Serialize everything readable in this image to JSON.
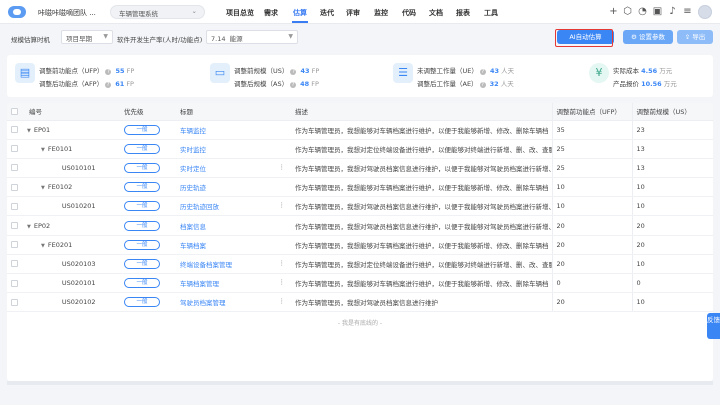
{
  "header": {
    "team_name": "咔嗞咔嗞嘀团队 ...",
    "project_select": "车辆管理系统",
    "nav": [
      {
        "label": "项目总览",
        "active": false
      },
      {
        "label": "需求",
        "active": false
      },
      {
        "label": "估算",
        "active": true
      },
      {
        "label": "迭代",
        "active": false
      },
      {
        "label": "评审",
        "active": false
      },
      {
        "label": "监控",
        "active": false
      },
      {
        "label": "代码",
        "active": false
      },
      {
        "label": "文档",
        "active": false
      },
      {
        "label": "报表",
        "active": false
      },
      {
        "label": "工具",
        "active": false
      }
    ],
    "icons": [
      "plus-icon",
      "cube-icon",
      "pie-chart-icon",
      "calendar-icon",
      "bell-icon",
      "settings-sliders-icon",
      "avatar"
    ]
  },
  "filters": {
    "timing_label": "规模估算时机",
    "timing_value": "项目早期",
    "productivity_label": "软件开发生产率(人时/功能点)",
    "productivity_value": "7.14",
    "productivity_level": "能源"
  },
  "actions": {
    "ai_estimate": "AI自动估算",
    "set_params": "设置参数",
    "export": "导出"
  },
  "summary": {
    "ufp_label": "调整前功能点（UFP）",
    "ufp_value": "55",
    "ufp_unit": "FP",
    "afp_label": "调整后功能点（AFP）",
    "afp_value": "61",
    "afp_unit": "FP",
    "us_label": "调整前规模（US）",
    "us_value": "43",
    "us_unit": "FP",
    "as_label": "调整后规模（AS）",
    "as_value": "48",
    "as_unit": "FP",
    "ue_label": "未调整工作量（UE）",
    "ue_value": "43",
    "ue_unit": "人天",
    "ae_label": "调整后工作量（AE）",
    "ae_value": "32",
    "ae_unit": "人天",
    "cost_label": "实际成本",
    "cost_value": "4.56",
    "cost_unit": "万元",
    "quote_label": "产品报价",
    "quote_value": "10.56",
    "quote_unit": "万元"
  },
  "table": {
    "columns": [
      "编号",
      "优先级",
      "标题",
      "描述",
      "调整前功能点（UFP）",
      "调整前规模（US）"
    ],
    "rows": [
      {
        "id": "EP01",
        "indent": 0,
        "caret": "down",
        "priority": "一般",
        "title": "车辆监控",
        "desc": "作为车辆管理员，我想能够对车辆档案进行维护，以便于我能够新增、修改、删除车辆档",
        "ufp": "35",
        "us": "23",
        "dots": false
      },
      {
        "id": "FE0101",
        "indent": 1,
        "caret": "down",
        "priority": "一般",
        "title": "实时监控",
        "desc": "作为车辆管理员，我想对定位终端设备进行维护，以便能够对终端进行新增、删、改、查服",
        "ufp": "25",
        "us": "13",
        "dots": false
      },
      {
        "id": "US010101",
        "indent": 2,
        "caret": "",
        "priority": "一般",
        "title": "实时定位",
        "desc": "作为车辆管理员，我想对驾驶员档案信息进行维护，以便于我能够对驾驶员档案进行新增、",
        "ufp": "25",
        "us": "13",
        "dots": true
      },
      {
        "id": "FE0102",
        "indent": 1,
        "caret": "down",
        "priority": "一般",
        "title": "历史轨迹",
        "desc": "作为车辆管理员，我想能够对车辆档案进行维护，以便于我能够新增、修改、删除车辆档",
        "ufp": "10",
        "us": "10",
        "dots": false
      },
      {
        "id": "US010201",
        "indent": 2,
        "caret": "",
        "priority": "一般",
        "title": "历史轨迹回放",
        "desc": "作为车辆管理员，我想对驾驶员档案信息进行维护，以便于我能够对驾驶员档案进行新增、",
        "ufp": "10",
        "us": "10",
        "dots": true
      },
      {
        "id": "EP02",
        "indent": 0,
        "caret": "down",
        "priority": "一般",
        "title": "档案信息",
        "desc": "作为车辆管理员，我想对驾驶员档案信息进行维护，以便于我能够对驾驶员档案进行新增、",
        "ufp": "20",
        "us": "20",
        "dots": false
      },
      {
        "id": "FE0201",
        "indent": 1,
        "caret": "down",
        "priority": "一般",
        "title": "车辆档案",
        "desc": "作为车辆管理员，我想能够对车辆档案进行维护，以便于我能够新增、修改、删除车辆档",
        "ufp": "20",
        "us": "20",
        "dots": false
      },
      {
        "id": "US020103",
        "indent": 2,
        "caret": "",
        "priority": "一般",
        "title": "终端设备档案管理",
        "desc": "作为车辆管理员，我想对定位终端设备进行维护，以便能够对终端进行新增、删、改、查服",
        "ufp": "20",
        "us": "10",
        "dots": true
      },
      {
        "id": "US020101",
        "indent": 2,
        "caret": "",
        "priority": "一般",
        "title": "车辆档案管理",
        "desc": "作为车辆管理员，我想能够对车辆档案进行维护，以便于我能够新增、修改、删除车辆档",
        "ufp": "0",
        "us": "0",
        "dots": true
      },
      {
        "id": "US020102",
        "indent": 2,
        "caret": "",
        "priority": "一般",
        "title": "驾驶员档案管理",
        "desc": "作为车辆管理员，我想对驾驶员档案信息进行维护",
        "ufp": "20",
        "us": "10",
        "dots": true
      }
    ],
    "end_text": "- 我是有底线的 -"
  },
  "side_feedback": "反馈"
}
